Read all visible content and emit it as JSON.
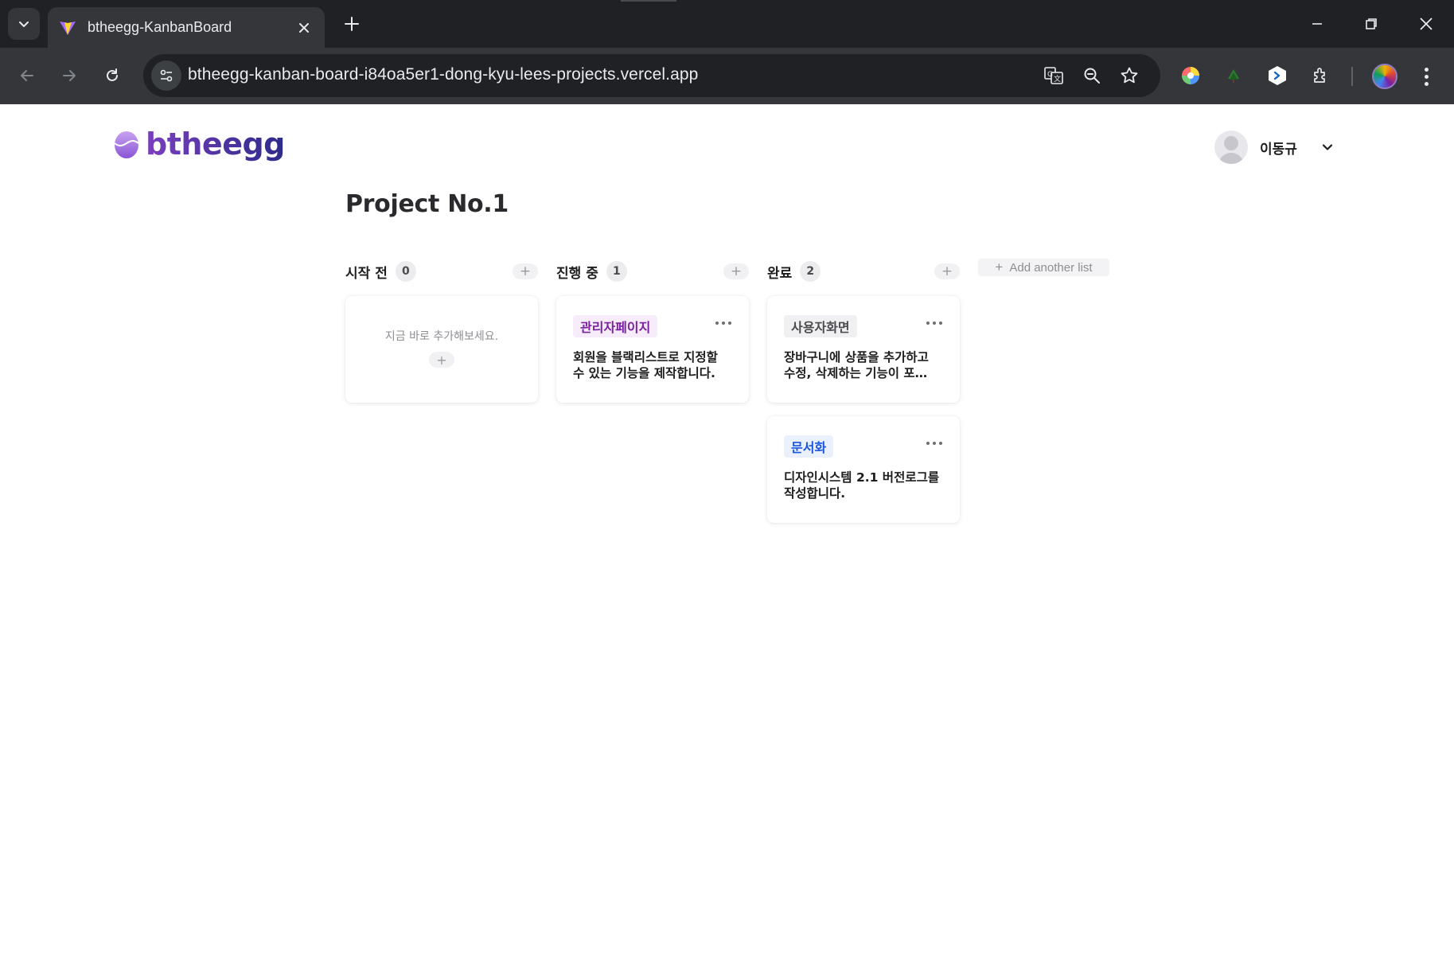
{
  "browser": {
    "tab_title": "btheegg-KanbanBoard",
    "url": "btheegg-kanban-board-i84oa5er1-dong-kyu-lees-projects.vercel.app"
  },
  "header": {
    "logo_text": "btheegg",
    "user_name": "이동규"
  },
  "project": {
    "title": "Project No.1"
  },
  "columns": [
    {
      "title": "시작 전",
      "count": "0",
      "empty_text": "지금 바로 추가해보세요."
    },
    {
      "title": "진행 중",
      "count": "1"
    },
    {
      "title": "완료",
      "count": "2"
    }
  ],
  "cards": {
    "in_progress": [
      {
        "tag": "관리자페이지",
        "tag_color": "#7b1fa2",
        "tag_bg": "#f7ecf9",
        "description": "회원을 블랙리스트로 지정할 수 있는 기능을 제작합니다."
      }
    ],
    "done": [
      {
        "tag": "사용자화면",
        "tag_color": "#4a4a4f",
        "tag_bg": "#f0f0f2",
        "description": "장바구니에 상품을 추가하고 수정, 삭제하는 기능이 포…"
      },
      {
        "tag": "문서화",
        "tag_color": "#1a56db",
        "tag_bg": "#eaf1fd",
        "description": "디자인시스템 2.1 버전로그를 작성합니다."
      }
    ]
  },
  "add_list_label": "Add another list",
  "colors": {
    "brand_purple": "#5b2aa3",
    "chrome_dark": "#202124",
    "chrome_toolbar": "#35363a"
  }
}
